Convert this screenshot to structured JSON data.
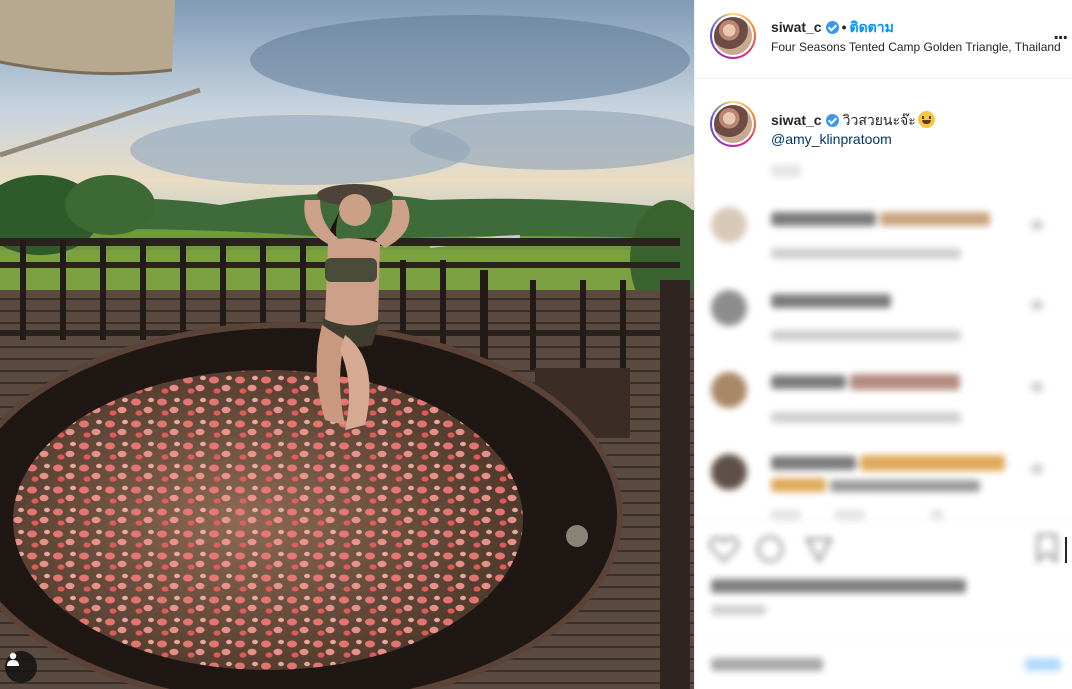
{
  "post": {
    "username": "siwat_c",
    "follow_label": "ติดตาม",
    "location": "Four Seasons Tented Camp Golden Triangle, Thailand",
    "caption_username": "siwat_c",
    "caption_text": "วิวสวยนะจ๊ะ",
    "caption_mention": "@amy_klinpratoom",
    "more_label": "..."
  },
  "icons": {
    "verified": "verified-badge-icon",
    "emoji": "grinning-face-emoji",
    "tag_user": "user-tag-icon",
    "more": "more-options-icon",
    "like": "heart-icon",
    "comment": "comment-icon",
    "share": "share-icon",
    "save": "bookmark-icon"
  },
  "colors": {
    "accent": "#0095f6",
    "mention": "#00376b",
    "verified": "#3897f0"
  }
}
